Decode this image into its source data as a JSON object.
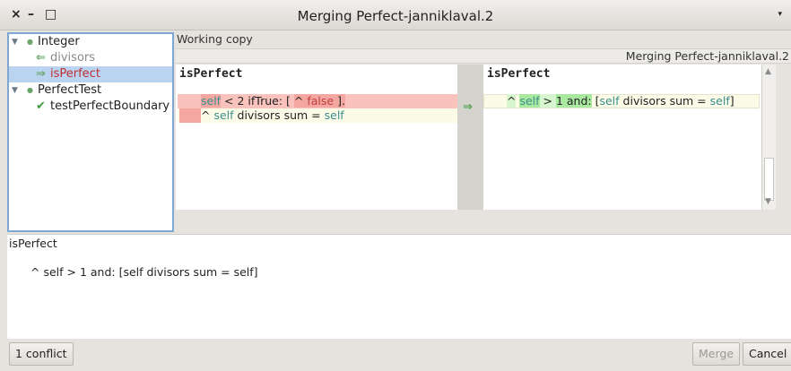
{
  "window": {
    "title": "Merging Perfect-janniklaval.2",
    "close_glyph": "×",
    "minimize_glyph": "–",
    "maximize_glyph": "□",
    "menu_glyph": "▾"
  },
  "tree": {
    "items": [
      {
        "label": "Integer",
        "twisty": "▼",
        "dot": "●"
      },
      {
        "label": "divisors",
        "icon": "⇐"
      },
      {
        "label": "isPerfect",
        "icon": "⇒",
        "selected": true
      },
      {
        "label": "PerfectTest",
        "twisty": "▼",
        "dot": "●"
      },
      {
        "label": "testPerfectBoundary",
        "icon": "✔"
      }
    ]
  },
  "diff": {
    "working_copy_label": "Working copy",
    "merging_label": "Merging Perfect-janniklaval.2",
    "left_title": "isPerfect",
    "right_title": "isPerfect",
    "gutter_arrow": "⇒",
    "left_line1": {
      "self": "self",
      "mid": " < 2 ifTrue: [ ",
      "caret": "^",
      "false": " false ",
      "end": "]."
    },
    "left_line2": {
      "caret": "^",
      "self1": "self",
      "mid": " divisors sum = ",
      "self2": "self"
    },
    "right_line1": {
      "caret": "^",
      "self1": "self",
      "gt": " > ",
      "one": "1",
      "and": " and:",
      "open": " [",
      "self2": "self",
      "mid": " divisors sum = ",
      "self3": "self",
      "close": "]"
    }
  },
  "preview": {
    "title": "isPerfect",
    "code": "^ self > 1 and: [self divisors sum = self]"
  },
  "footer": {
    "conflict_label": "1 conflict",
    "merge_label": "Merge",
    "cancel_label": "Cancel"
  },
  "scrollbar": {
    "up_glyph": "▲",
    "down_glyph": "▼"
  }
}
